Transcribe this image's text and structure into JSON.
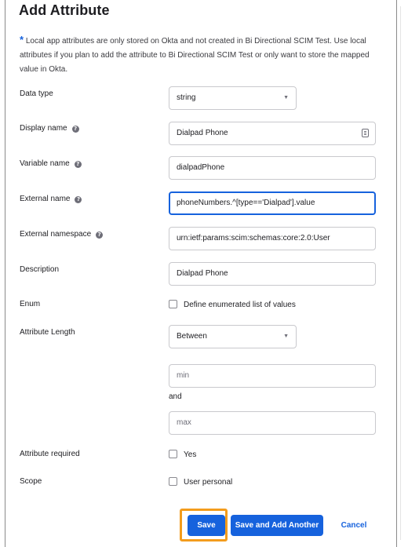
{
  "dialog": {
    "title": "Add Attribute",
    "info_star": "*",
    "info_text": "Local app attributes are only stored on Okta and not created in Bi Directional SCIM Test. Use local attributes if you plan to add the attribute to Bi Directional SCIM Test or only want to store the mapped value in Okta."
  },
  "form": {
    "data_type": {
      "label": "Data type",
      "value": "string"
    },
    "display_name": {
      "label": "Display name",
      "value": "Dialpad Phone"
    },
    "variable_name": {
      "label": "Variable name",
      "value": "dialpadPhone"
    },
    "external_name": {
      "label": "External name",
      "value": "phoneNumbers.^[type=='Dialpad'].value"
    },
    "external_namespace": {
      "label": "External namespace",
      "value": "urn:ietf:params:scim:schemas:core:2.0:User"
    },
    "description": {
      "label": "Description",
      "value": "Dialpad Phone"
    },
    "enum": {
      "label": "Enum",
      "checkbox_label": "Define enumerated list of values"
    },
    "attribute_length": {
      "label": "Attribute Length",
      "value": "Between",
      "min_placeholder": "min",
      "and_label": "and",
      "max_placeholder": "max"
    },
    "attribute_required": {
      "label": "Attribute required",
      "checkbox_label": "Yes"
    },
    "scope": {
      "label": "Scope",
      "checkbox_label": "User personal"
    },
    "help_glyph": "?"
  },
  "footer": {
    "save_label": "Save",
    "save_add_label": "Save and Add Another",
    "cancel_label": "Cancel"
  },
  "colors": {
    "primary": "#1662dd",
    "highlight": "#f39c1c"
  }
}
